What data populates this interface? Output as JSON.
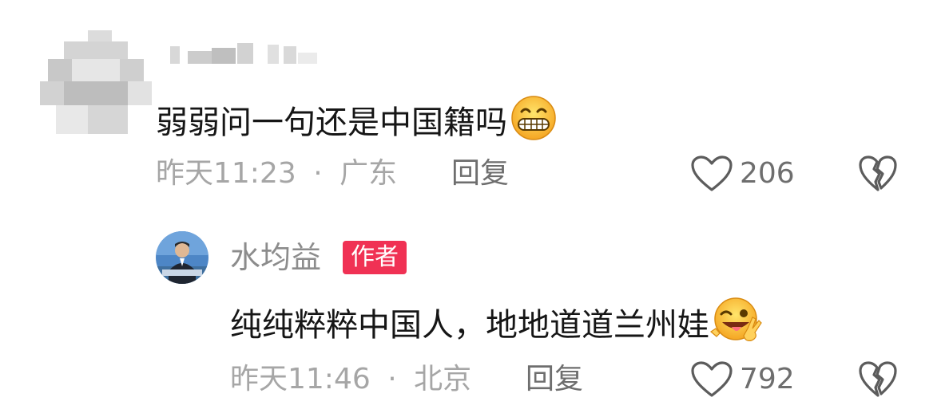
{
  "comment": {
    "username_redacted": true,
    "text": "弱弱问一句还是中国籍吗",
    "emoji": "grinning-teeth-emoji",
    "time": "昨天11:23",
    "separator": "·",
    "location": "广东",
    "reply_label": "回复",
    "like_count": "206",
    "icons": {
      "like": "heart-outline-icon",
      "dislike": "broken-heart-icon"
    }
  },
  "reply": {
    "author_name": "水均益",
    "author_badge": "作者",
    "text": "纯纯粹粹中国人，地地道道兰州娃",
    "emoji": "winking-tongue-emoji",
    "time": "昨天11:46",
    "separator": "·",
    "location": "北京",
    "reply_label": "回复",
    "like_count": "792",
    "icons": {
      "like": "heart-outline-icon",
      "dislike": "broken-heart-icon"
    }
  },
  "colors": {
    "badge_bg": "#f03154",
    "body_text": "#161616",
    "meta_text": "#a6a6a6",
    "action_text": "#6e6e6e"
  }
}
